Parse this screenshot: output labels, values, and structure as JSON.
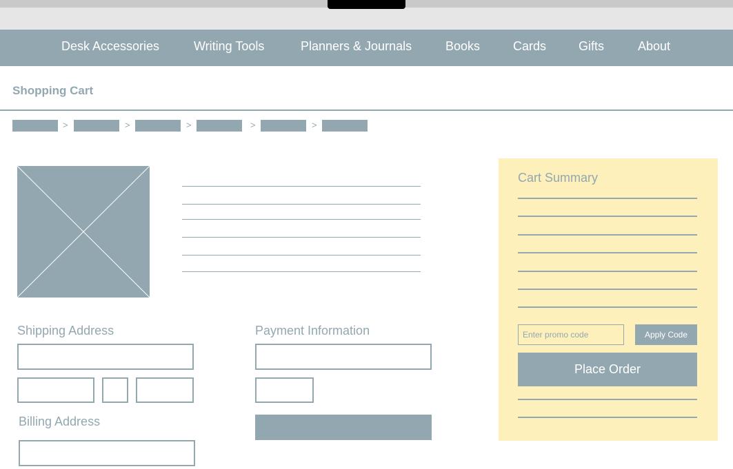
{
  "nav": {
    "items": [
      {
        "label": "Desk Accessories"
      },
      {
        "label": "Writing Tools"
      },
      {
        "label": "Planners & Journals"
      },
      {
        "label": "Books"
      },
      {
        "label": "Cards"
      },
      {
        "label": "Gifts"
      },
      {
        "label": "About"
      }
    ]
  },
  "page": {
    "title": "Shopping Cart"
  },
  "breadcrumb": {
    "separator": ">"
  },
  "sections": {
    "shipping": "Shipping Address",
    "payment": "Payment Information",
    "billing": "Billing Address"
  },
  "summary": {
    "title": "Cart Summary",
    "promo_placeholder": "Enter promo code",
    "apply_label": "Apply Code",
    "place_order_label": "Place Order"
  },
  "colors": {
    "accent": "#93a7b0",
    "summary_background": "#fdf0bb",
    "chrome": "#e6e6e6"
  }
}
